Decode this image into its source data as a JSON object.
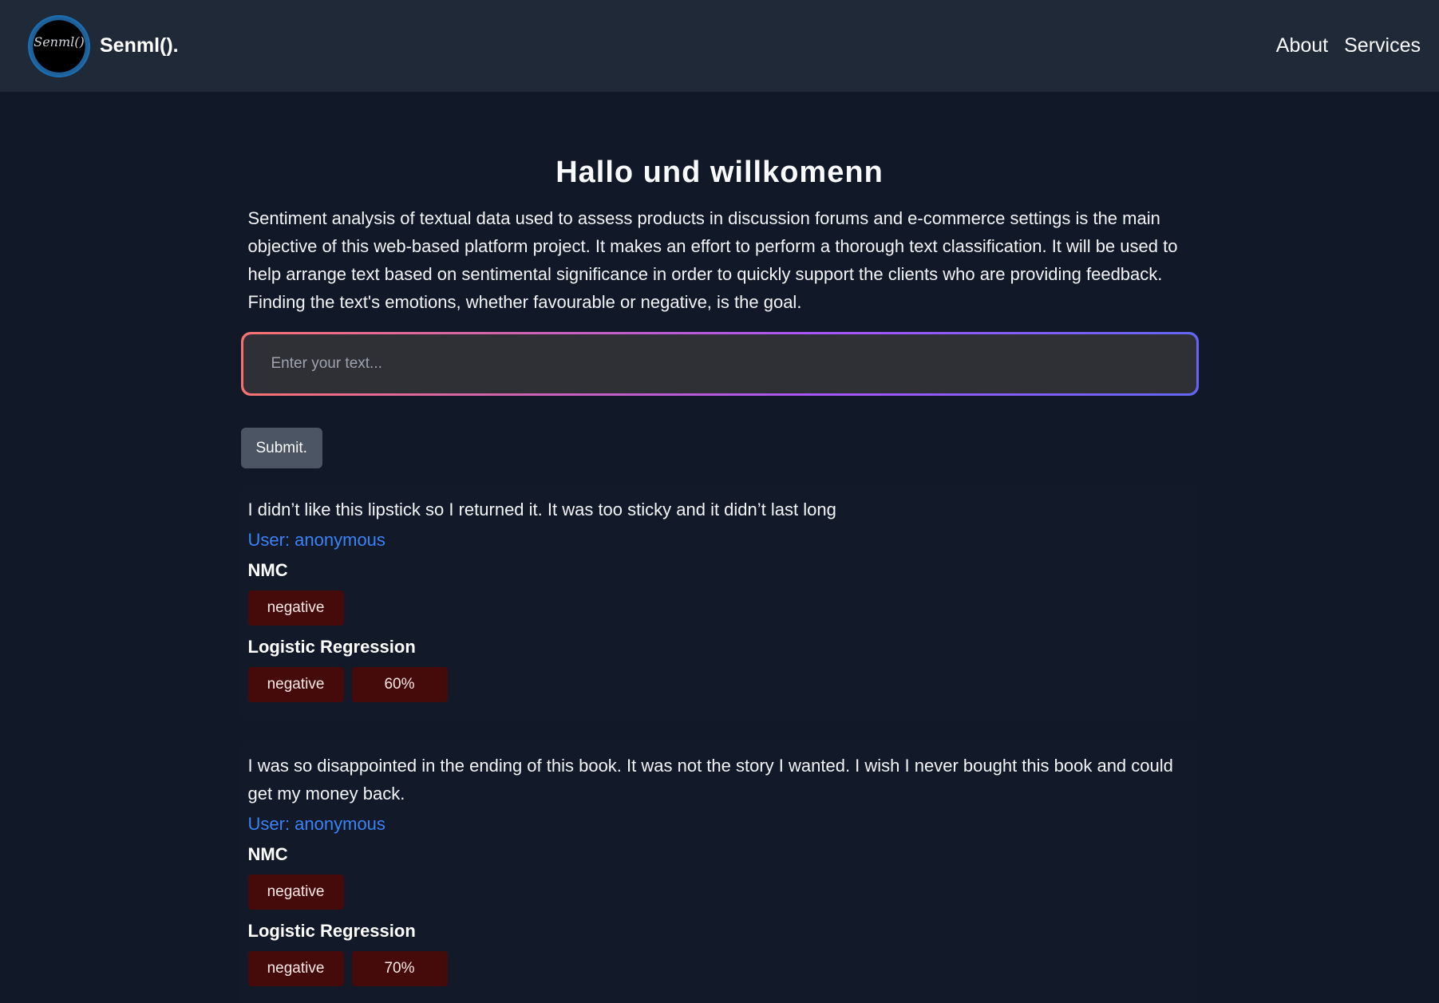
{
  "header": {
    "logo_text": "Senml()",
    "brand": "Senml().",
    "nav": [
      "About",
      "Services"
    ]
  },
  "main": {
    "title": "Hallo und willkomenn",
    "intro": "Sentiment analysis of textual data used to assess products in discussion forums and e-commerce settings is the main objective of this web-based platform project. It makes an effort to perform a thorough text classification. It will be used to help arrange text based on sentimental significance in order to quickly support the clients who are providing feedback. Finding the text's emotions, whether favourable or negative, is the goal.",
    "input_placeholder": "Enter your text...",
    "submit_label": "Submit."
  },
  "results": [
    {
      "text": "I didn’t like this lipstick so I returned it. It was too sticky and it didn’t last long",
      "user": "User: anonymous",
      "nmc_label": "NMC",
      "nmc_result": "negative",
      "lr_label": "Logistic Regression",
      "lr_result": "negative",
      "lr_confidence": "60%"
    },
    {
      "text": "I was so disappointed in the ending of this book. It was not the story I wanted. I wish I never bought this book and could get my money back.",
      "user": "User: anonymous",
      "nmc_label": "NMC",
      "nmc_result": "negative",
      "lr_label": "Logistic Regression",
      "lr_result": "negative",
      "lr_confidence": "70%"
    }
  ],
  "colors": {
    "page_bg": "#111827",
    "nav_bg": "#1f2937",
    "user_link": "#3b82f6",
    "negative_badge": "#450a0a"
  }
}
